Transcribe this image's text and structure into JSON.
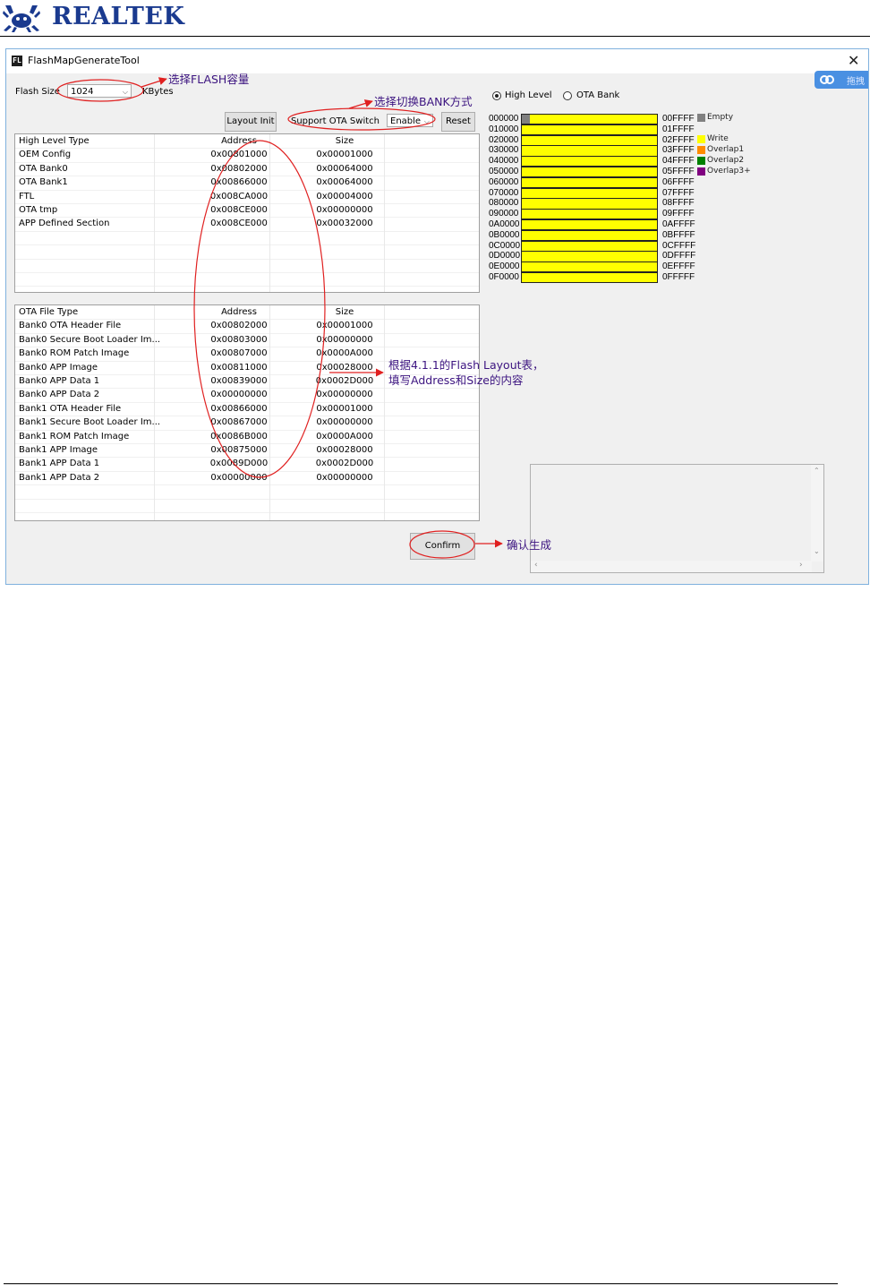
{
  "header": {
    "brand": "REALTEK"
  },
  "window": {
    "title": "FlashMapGenerateTool",
    "close_glyph": "✕",
    "side_tab": "拖拽"
  },
  "toolbar": {
    "flash_size_label": "Flash Size",
    "flash_size_value": "1024",
    "flash_size_unit": "KBytes",
    "layout_init": "Layout Init",
    "ota_switch_label": "Support OTA Switch",
    "ota_switch_value": "Enable",
    "reset": "Reset",
    "radio_high_level": "High Level",
    "radio_ota_bank": "OTA Bank",
    "high_level_selected": true
  },
  "high_level_table": {
    "columns": [
      "High Level Type",
      "Address",
      "Size"
    ],
    "rows": [
      [
        "OEM Config",
        "0x00801000",
        "0x00001000"
      ],
      [
        "OTA Bank0",
        "0x00802000",
        "0x00064000"
      ],
      [
        "OTA Bank1",
        "0x00866000",
        "0x00064000"
      ],
      [
        "FTL",
        "0x008CA000",
        "0x00004000"
      ],
      [
        "OTA tmp",
        "0x008CE000",
        "0x00000000"
      ],
      [
        "APP Defined Section",
        "0x008CE000",
        "0x00032000"
      ]
    ]
  },
  "ota_file_table": {
    "columns": [
      "OTA File Type",
      "Address",
      "Size"
    ],
    "rows": [
      [
        "Bank0 OTA Header File",
        "0x00802000",
        "0x00001000"
      ],
      [
        "Bank0 Secure Boot Loader Im...",
        "0x00803000",
        "0x00000000"
      ],
      [
        "Bank0 ROM Patch Image",
        "0x00807000",
        "0x0000A000"
      ],
      [
        "Bank0 APP Image",
        "0x00811000",
        "0x00028000"
      ],
      [
        "Bank0 APP Data 1",
        "0x00839000",
        "0x0002D000"
      ],
      [
        "Bank0 APP Data 2",
        "0x00000000",
        "0x00000000"
      ],
      [
        "Bank1 OTA Header File",
        "0x00866000",
        "0x00001000"
      ],
      [
        "Bank1 Secure Boot Loader Im...",
        "0x00867000",
        "0x00000000"
      ],
      [
        "Bank1 ROM Patch Image",
        "0x0086B000",
        "0x0000A000"
      ],
      [
        "Bank1 APP Image",
        "0x00875000",
        "0x00028000"
      ],
      [
        "Bank1 APP Data 1",
        "0x0089D000",
        "0x0002D000"
      ],
      [
        "Bank1 APP Data 2",
        "0x00000000",
        "0x00000000"
      ]
    ]
  },
  "flash_map": {
    "start": [
      "000000",
      "010000",
      "020000",
      "030000",
      "040000",
      "050000",
      "060000",
      "070000",
      "080000",
      "090000",
      "0A0000",
      "0B0000",
      "0C0000",
      "0D0000",
      "0E0000",
      "0F0000"
    ],
    "end": [
      "00FFFF",
      "01FFFF",
      "02FFFF",
      "03FFFF",
      "04FFFF",
      "05FFFF",
      "06FFFF",
      "07FFFF",
      "08FFFF",
      "09FFFF",
      "0AFFFF",
      "0BFFFF",
      "0CFFFF",
      "0DFFFF",
      "0EFFFF",
      "0FFFFF"
    ],
    "fill_color": "#ffff00"
  },
  "legend": [
    {
      "label": "Empty",
      "color": "#808080"
    },
    {
      "label": "Write",
      "color": "#ffff00"
    },
    {
      "label": "Overlap1",
      "color": "#ff8c00"
    },
    {
      "label": "Overlap2",
      "color": "#008000"
    },
    {
      "label": "Overlap3+",
      "color": "#800080"
    }
  ],
  "confirm": "Confirm",
  "annotations": {
    "flash_size": "选择FLASH容量",
    "bank_mode": "选择切换BANK方式",
    "fill_table_line1": "根据4.1.1的Flash Layout表，",
    "fill_table_line2": "填写Address和Size的内容",
    "confirm": "确认生成"
  },
  "colors": {
    "annotation_text": "#3c1480",
    "annotation_ellipse": "#e02020",
    "brand": "#1a3a8f"
  }
}
